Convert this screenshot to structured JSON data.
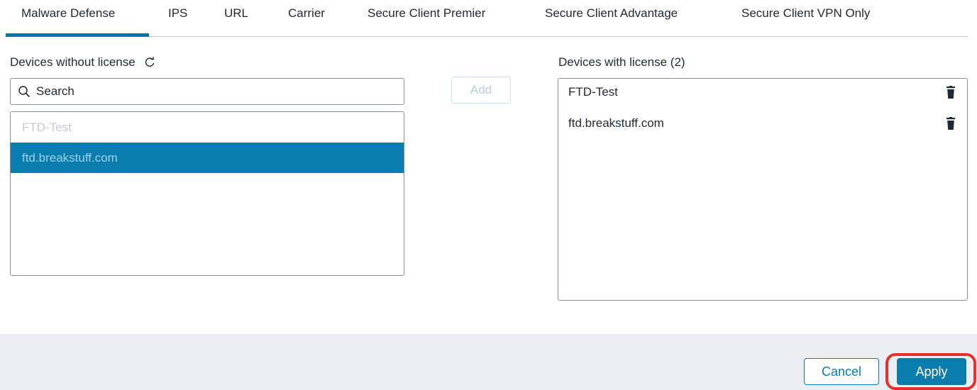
{
  "tabs": [
    {
      "label": "Malware Defense",
      "active": true
    },
    {
      "label": "IPS"
    },
    {
      "label": "URL"
    },
    {
      "label": "Carrier"
    },
    {
      "label": "Secure Client Premier"
    },
    {
      "label": "Secure Client Advantage"
    },
    {
      "label": "Secure Client VPN Only"
    }
  ],
  "left_panel": {
    "title": "Devices without license",
    "refresh_icon": "refresh-icon",
    "search": {
      "placeholder": "Search",
      "value": ""
    },
    "devices": [
      {
        "name": "FTD-Test",
        "state": "disabled"
      },
      {
        "name": "ftd.breakstuff.com",
        "state": "selected"
      }
    ]
  },
  "add_button": {
    "label": "Add",
    "enabled": false
  },
  "right_panel": {
    "title": "Devices with license (2)",
    "devices": [
      {
        "name": "FTD-Test",
        "icon": "trash-icon"
      },
      {
        "name": "ftd.breakstuff.com",
        "icon": "trash-icon"
      }
    ]
  },
  "footer": {
    "cancel_label": "Cancel",
    "apply_label": "Apply",
    "highlight_color": "#e8302a"
  },
  "colors": {
    "accent": "#0a7daf",
    "tab_underline": "#0576a8",
    "footer_bg": "#eceff2"
  }
}
